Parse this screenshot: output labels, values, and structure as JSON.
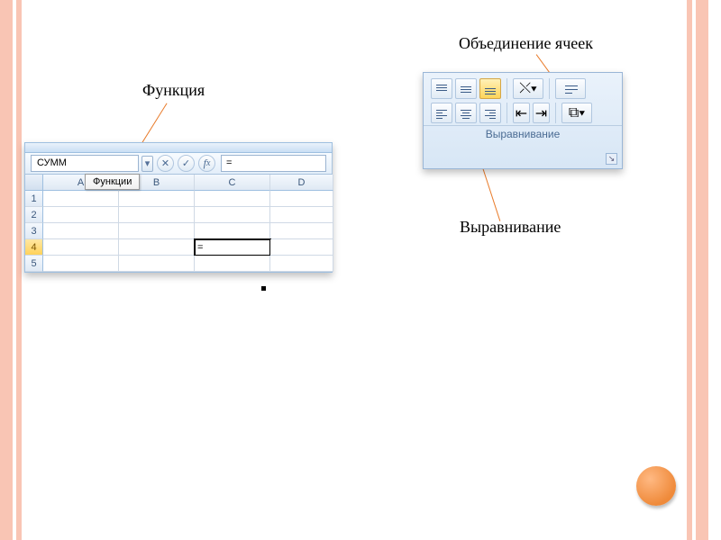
{
  "captions": {
    "function": "Функция",
    "merge": "Объединение ячеек",
    "alignment": "Выравнивание"
  },
  "tooltip": "Функции",
  "excel": {
    "name_box_value": "СУММ",
    "formula_bar_value": "=",
    "columns": [
      "A",
      "B",
      "C",
      "D"
    ],
    "rows": [
      "1",
      "2",
      "3",
      "4",
      "5"
    ],
    "active_cell_content": "=",
    "active_row": "4"
  },
  "ribbon": {
    "group_title": "Выравнивание"
  }
}
